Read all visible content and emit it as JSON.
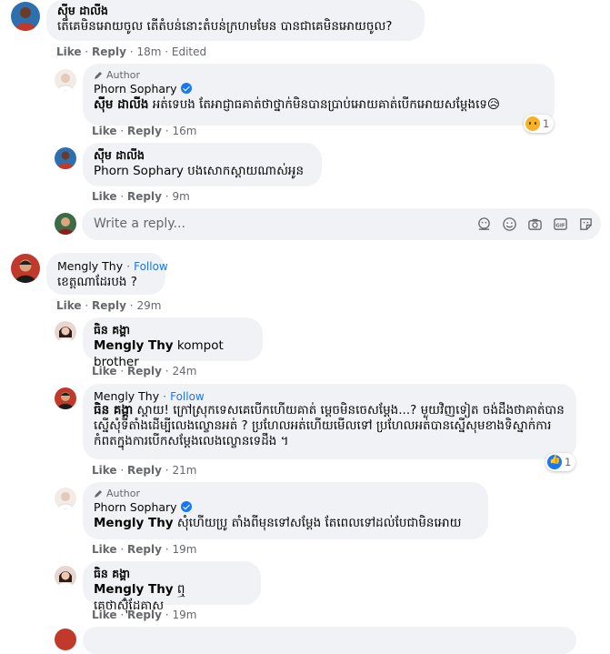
{
  "actions": {
    "like": "Like",
    "reply": "Reply",
    "sep": "·"
  },
  "comment1": {
    "name": "ស៊ីម ដាលីង",
    "text": "តើគេមិនអោយចូល តើតំបន់នោះតំបន់ក្រហមមែន បានជាគេមិនអោយចូល?",
    "time": "18m",
    "edited": "Edited"
  },
  "reply1": {
    "author_label": "Author",
    "name": "Phorn Sophary",
    "tag": "ស៊ីម ដាលីង",
    "text": " អត់ទេបង តែអាជ្ញាធគាត់ថាថ្នាក់មិនបានប្រាប់អោយគាត់បើកអោយសម្តែងទេ😥",
    "time": "16m",
    "reaction_count": "1"
  },
  "reply2": {
    "name": "ស៊ីម ដាលីង",
    "tag": "Phorn Sophary",
    "text": " បងសោកស្តាយណាស់អូន",
    "time": "9m"
  },
  "reply_input": {
    "placeholder": "Write a reply..."
  },
  "comment2": {
    "name": "Mengly Thy",
    "follow": "Follow",
    "text": "ខេត្តណាដែរបង ?",
    "time": "29m"
  },
  "reply3": {
    "name": "ធិន គង្គា",
    "tag": "Mengly Thy",
    "text": " kompot brother",
    "time": "24m"
  },
  "reply4": {
    "name": "Mengly Thy",
    "follow": "Follow",
    "tag": "ធិន គង្គា",
    "text": " ស្តាយ! ក្រៅស្រុកទេសគេបើកហើយគាត់ ម្ដេចមិនចេសម្ដែង...? មួយវិញទៀត ចង់ដឹងថាគាត់បានស្នើសុំទីតាំងដើម្បីលេងល្ខោនអត់ ? ប្រហែលអត់ហើយមើលទៅ ប្រហែលអត់បានស្នើសុមខាងទិស្នាក់ការកំពតក្នុងការបើកសម្ដែងលេងល្ខោនទេដឹង ។",
    "time": "21m",
    "reaction_count": "1"
  },
  "reply5": {
    "author_label": "Author",
    "name": "Phorn Sophary",
    "tag": "Mengly Thy",
    "text": " សុំហើយប្រូ តាំងពីមុនទៅសម្ដែង តែពេលទៅដល់បែជាមិនអោយ",
    "time": "19m"
  },
  "reply6": {
    "name": "ធិន គង្គា",
    "tag": "Mengly Thy",
    "text": " ឮគេថាស៊ុំដែគាស",
    "time": "19m"
  },
  "colors": {
    "link": "#1877f2",
    "meta": "#65676b",
    "bubble": "#f0f2f5"
  }
}
